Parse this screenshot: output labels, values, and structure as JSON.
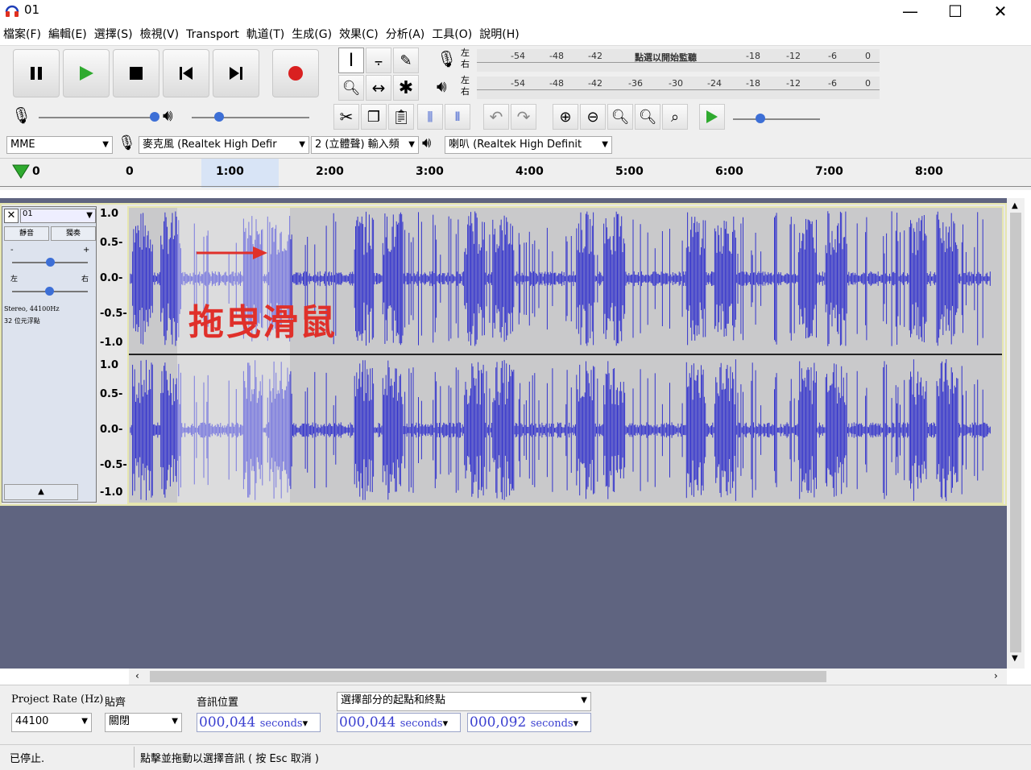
{
  "window": {
    "title": "01",
    "minimize": "—",
    "maximize": "☐",
    "close": "✕"
  },
  "menu": [
    "檔案(F)",
    "編輯(E)",
    "選擇(S)",
    "檢視(V)",
    "Transport",
    "軌道(T)",
    "生成(G)",
    "效果(C)",
    "分析(A)",
    "工具(O)",
    "說明(H)"
  ],
  "meters": {
    "record": {
      "lr": "左\n右",
      "ticks": [
        "-54",
        "-48",
        "-42",
        "點選以開始監聽",
        "-18",
        "-12",
        "-6",
        "0"
      ]
    },
    "playback": {
      "lr": "左\n右",
      "ticks": [
        "-54",
        "-48",
        "-42",
        "-36",
        "-30",
        "-24",
        "-18",
        "-12",
        "-6",
        "0"
      ]
    }
  },
  "devices": {
    "host": "MME",
    "input": "麥克風 (Realtek High Defir",
    "channels": "2 (立體聲) 輸入頻",
    "output": "喇叭 (Realtek High Definit"
  },
  "timeline": {
    "labels": [
      "0",
      "0",
      "1:00",
      "2:00",
      "3:00",
      "4:00",
      "5:00",
      "6:00",
      "7:00",
      "8:00"
    ]
  },
  "track": {
    "name": "01",
    "mute": "靜音",
    "solo": "獨奏",
    "gain_minus": "-",
    "gain_plus": "+",
    "pan_left": "左",
    "pan_right": "右",
    "info1": "Stereo, 44100Hz",
    "info2": "32 位元浮點",
    "scale": [
      "1.0",
      "0.5-",
      "0.0-",
      "-0.5-",
      "-1.0"
    ]
  },
  "annotation": {
    "text": "拖曳滑鼠",
    "color": "#e0302a"
  },
  "bottom": {
    "rate_label": "Project Rate (Hz)",
    "rate_value": "44100",
    "snap_label": "貼齊",
    "snap_value": "關閉",
    "audio_pos_label": "音訊位置",
    "audio_pos_value": "000,044",
    "unit": "seconds",
    "selection_mode": "選擇部分的起點和終點",
    "sel_start": "000,044",
    "sel_end": "000,092"
  },
  "status": {
    "left": "已停止.",
    "hint": "點擊並拖動以選擇音訊 ( 按 Esc 取消 )"
  },
  "colors": {
    "wave": "#3333cc",
    "wave_bg": "#c9c9cb",
    "track_area": "#5f6480",
    "record": "#d92020",
    "play": "#2faa2f"
  }
}
